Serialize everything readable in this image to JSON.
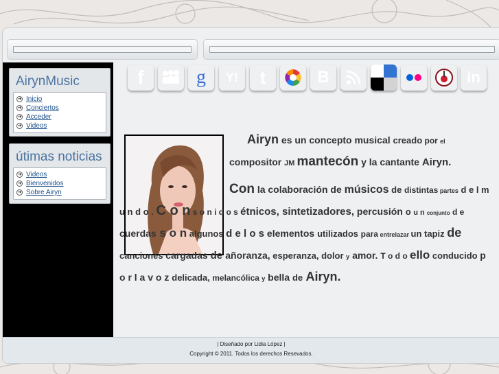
{
  "sidebar": {
    "title": "AirynMusic",
    "menu": [
      "Inicio",
      "Conciertos",
      "Acceder",
      "Videos"
    ],
    "news_title": "útimas noticias",
    "news": [
      "Videos",
      "Bienvenidos",
      "Sobre Airyn"
    ]
  },
  "social_icons": [
    {
      "name": "facebook",
      "glyph": "f",
      "color": "#3b5998"
    },
    {
      "name": "myspace",
      "glyph": "",
      "color": "#1d4f9c"
    },
    {
      "name": "google",
      "glyph": "g",
      "color": "#e8eef8"
    },
    {
      "name": "yahoo",
      "glyph": "Y!",
      "color": "#6a1f7d"
    },
    {
      "name": "twitter",
      "glyph": "t",
      "color": "#49b6e3"
    },
    {
      "name": "picasa",
      "glyph": "",
      "color": "#f2f2f2"
    },
    {
      "name": "blogger",
      "glyph": "B",
      "color": "#f57d00"
    },
    {
      "name": "rss",
      "glyph": "",
      "color": "#f26a21"
    },
    {
      "name": "delicious",
      "glyph": "",
      "color": "#ffffff"
    },
    {
      "name": "flickr",
      "glyph": "",
      "color": "#ffffff"
    },
    {
      "name": "lastfm",
      "glyph": "",
      "color": "#cc2030"
    },
    {
      "name": "linkedin",
      "glyph": "in",
      "color": "#1f73b7"
    }
  ],
  "bio": {
    "p1": [
      [
        "Airyn",
        18
      ],
      [
        " es un concepto musical ",
        14
      ],
      [
        "creado",
        13
      ],
      [
        " por ",
        12
      ],
      [
        "el",
        9
      ],
      [
        " compositor ",
        14
      ],
      [
        "JM ",
        11
      ],
      [
        "mantecón",
        19
      ],
      [
        " y la cantante ",
        14
      ],
      [
        "Airyn.",
        15
      ]
    ],
    "p2": [
      [
        "Con",
        19
      ],
      [
        " la colaboración de ",
        14
      ],
      [
        "músicos",
        16
      ],
      [
        " de ",
        13
      ],
      [
        "distintas",
        12
      ],
      [
        " partes",
        9
      ],
      [
        " d e l m u n d o . ",
        13
      ],
      [
        "C o n",
        20
      ],
      [
        " s o n i d o s ",
        12
      ],
      [
        "étnicos,",
        15
      ],
      [
        " sintetizadores,",
        15
      ],
      [
        " percusión ",
        14
      ],
      [
        "o ",
        13
      ],
      [
        "u n ",
        11
      ],
      [
        "conjunto",
        8
      ],
      [
        " d e ",
        12
      ],
      [
        "cuerdas",
        14
      ],
      [
        " s o n",
        17
      ],
      [
        " algunos ",
        13
      ],
      [
        "d e l o s",
        15
      ],
      [
        " elementos ",
        14
      ],
      [
        "utilizados ",
        13
      ],
      [
        "para",
        12
      ],
      [
        " entrelazar ",
        9
      ],
      [
        "un ",
        13
      ],
      [
        "tapiz ",
        13
      ],
      [
        "de",
        18
      ],
      [
        " canciones ",
        13
      ],
      [
        "cargadas ",
        14
      ],
      [
        "de ",
        15
      ],
      [
        "añoranza,",
        14
      ],
      [
        " esperanza,",
        13
      ],
      [
        " dolor ",
        13
      ],
      [
        "y",
        9
      ],
      [
        " amor. ",
        14
      ],
      [
        "T o d o ",
        12
      ],
      [
        "ello",
        17
      ],
      [
        " conducido ",
        13
      ],
      [
        "p o r l a v o z ",
        14
      ],
      [
        "delicada,",
        13
      ],
      [
        " melancólica ",
        12
      ],
      [
        "y",
        9
      ],
      [
        " bella ",
        14
      ],
      [
        "de",
        13
      ],
      [
        " Airyn.",
        18
      ]
    ]
  },
  "footer": {
    "line1": "| Diseñado por Lidia López |",
    "line2": "Copyright © 2011. Todos los derechos Resevados."
  },
  "colors": {
    "accent": "#4a73a0",
    "link": "#1d4f8a",
    "sidebar_bg": "#000000"
  }
}
